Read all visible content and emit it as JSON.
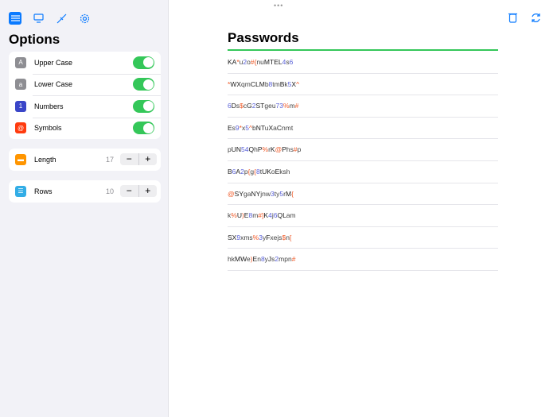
{
  "sidebar": {
    "title": "Options",
    "toggles": [
      {
        "label": "Upper Case",
        "glyph": "A",
        "color": "#8e8e93",
        "on": true
      },
      {
        "label": "Lower Case",
        "glyph": "a",
        "color": "#8e8e93",
        "on": true
      },
      {
        "label": "Numbers",
        "glyph": "1",
        "color": "#3a46c8",
        "on": true
      },
      {
        "label": "Symbols",
        "glyph": "@",
        "color": "#ff3b0f",
        "on": true
      }
    ],
    "length": {
      "label": "Length",
      "value": "17",
      "minus": "−",
      "plus": "+"
    },
    "rows": {
      "label": "Rows",
      "value": "10",
      "minus": "−",
      "plus": "+"
    }
  },
  "main": {
    "title": "Passwords",
    "more": "•••",
    "passwords": [
      "KA*u2o#{nuMTEL4s6",
      "*WXqmCLMb8tmBk5X^",
      "6Ds$cG2STgeu73%m#",
      "Es9*x5^bNTuXaCnmt",
      "pUN54QhP%rK@Phs#p",
      "B6A2p{g{8tUKoEksh",
      "@SYgaNYjnw3ty5rM{",
      "k%U)E8m#]K4j6QLam",
      "SX9xms%3yFxejs$n[",
      "hkMWe)En8yJs2mpn#"
    ]
  },
  "colors": {
    "accent": "#0a7aff",
    "green": "#34c759",
    "digit": "#5860d8",
    "symbol": "#f05a28"
  }
}
